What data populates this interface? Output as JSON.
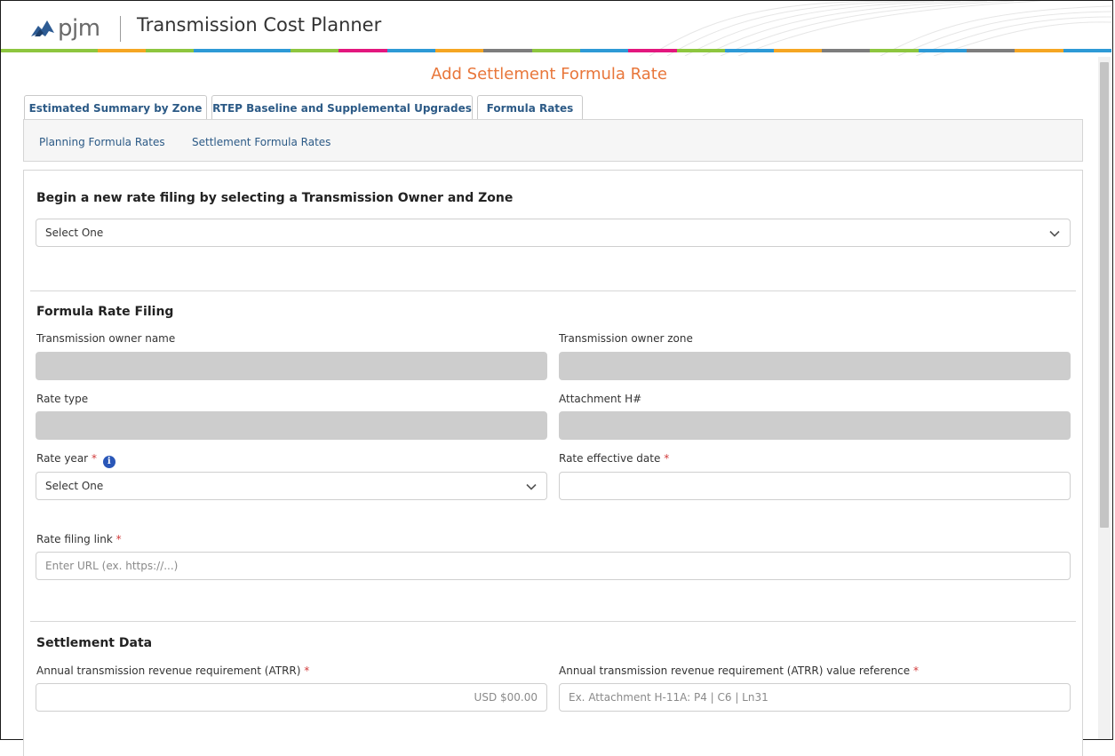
{
  "header": {
    "logo_text": "pjm",
    "app_title": "Transmission Cost Planner",
    "stripe_colors": [
      "#8dc63f",
      "#8dc63f",
      "#f5a623",
      "#8dc63f",
      "#2e9ad6",
      "#2e9ad6",
      "#8dc63f",
      "#e3177e",
      "#2e9ad6",
      "#f5a623",
      "#7d7d7d",
      "#8dc63f",
      "#2e9ad6",
      "#e3177e",
      "#8dc63f",
      "#2e9ad6",
      "#f5a623",
      "#7d7d7d",
      "#8dc63f",
      "#2e9ad6",
      "#7d7d7d",
      "#f5a623",
      "#2e9ad6"
    ]
  },
  "page_title": "Add Settlement Formula Rate",
  "tabs": [
    {
      "label": "Estimated Summary by Zone"
    },
    {
      "label": "RTEP Baseline and Supplemental Upgrades"
    },
    {
      "label": "Formula Rates"
    }
  ],
  "subnav": [
    {
      "label": "Planning Formula Rates"
    },
    {
      "label": "Settlement Formula Rates"
    }
  ],
  "begin": {
    "heading": "Begin a new rate filing by selecting a Transmission Owner and Zone",
    "select_value": "Select One"
  },
  "filing": {
    "heading": "Formula Rate Filing",
    "owner_name_label": "Transmission owner name",
    "owner_zone_label": "Transmission owner zone",
    "rate_type_label": "Rate type",
    "attachment_label": "Attachment H#",
    "rate_year_label": "Rate year",
    "rate_year_value": "Select One",
    "effective_date_label": "Rate effective date",
    "filing_link_label": "Rate filing link",
    "filing_link_placeholder": "Enter URL (ex. https://...)",
    "required_mark": "*",
    "info_icon": "i"
  },
  "settlement": {
    "heading": "Settlement Data",
    "atrr_label": "Annual transmission revenue requirement (ATRR)",
    "atrr_value": "USD $00.00",
    "atrr_ref_label": "Annual transmission revenue requirement (ATRR) value reference",
    "atrr_ref_placeholder": "Ex. Attachment H-11A: P4 | C6 | Ln31"
  },
  "colors": {
    "accent_orange": "#e8763a",
    "link_blue": "#2c5a86",
    "info_blue": "#2a57b8",
    "required_red": "#d23b3b"
  }
}
